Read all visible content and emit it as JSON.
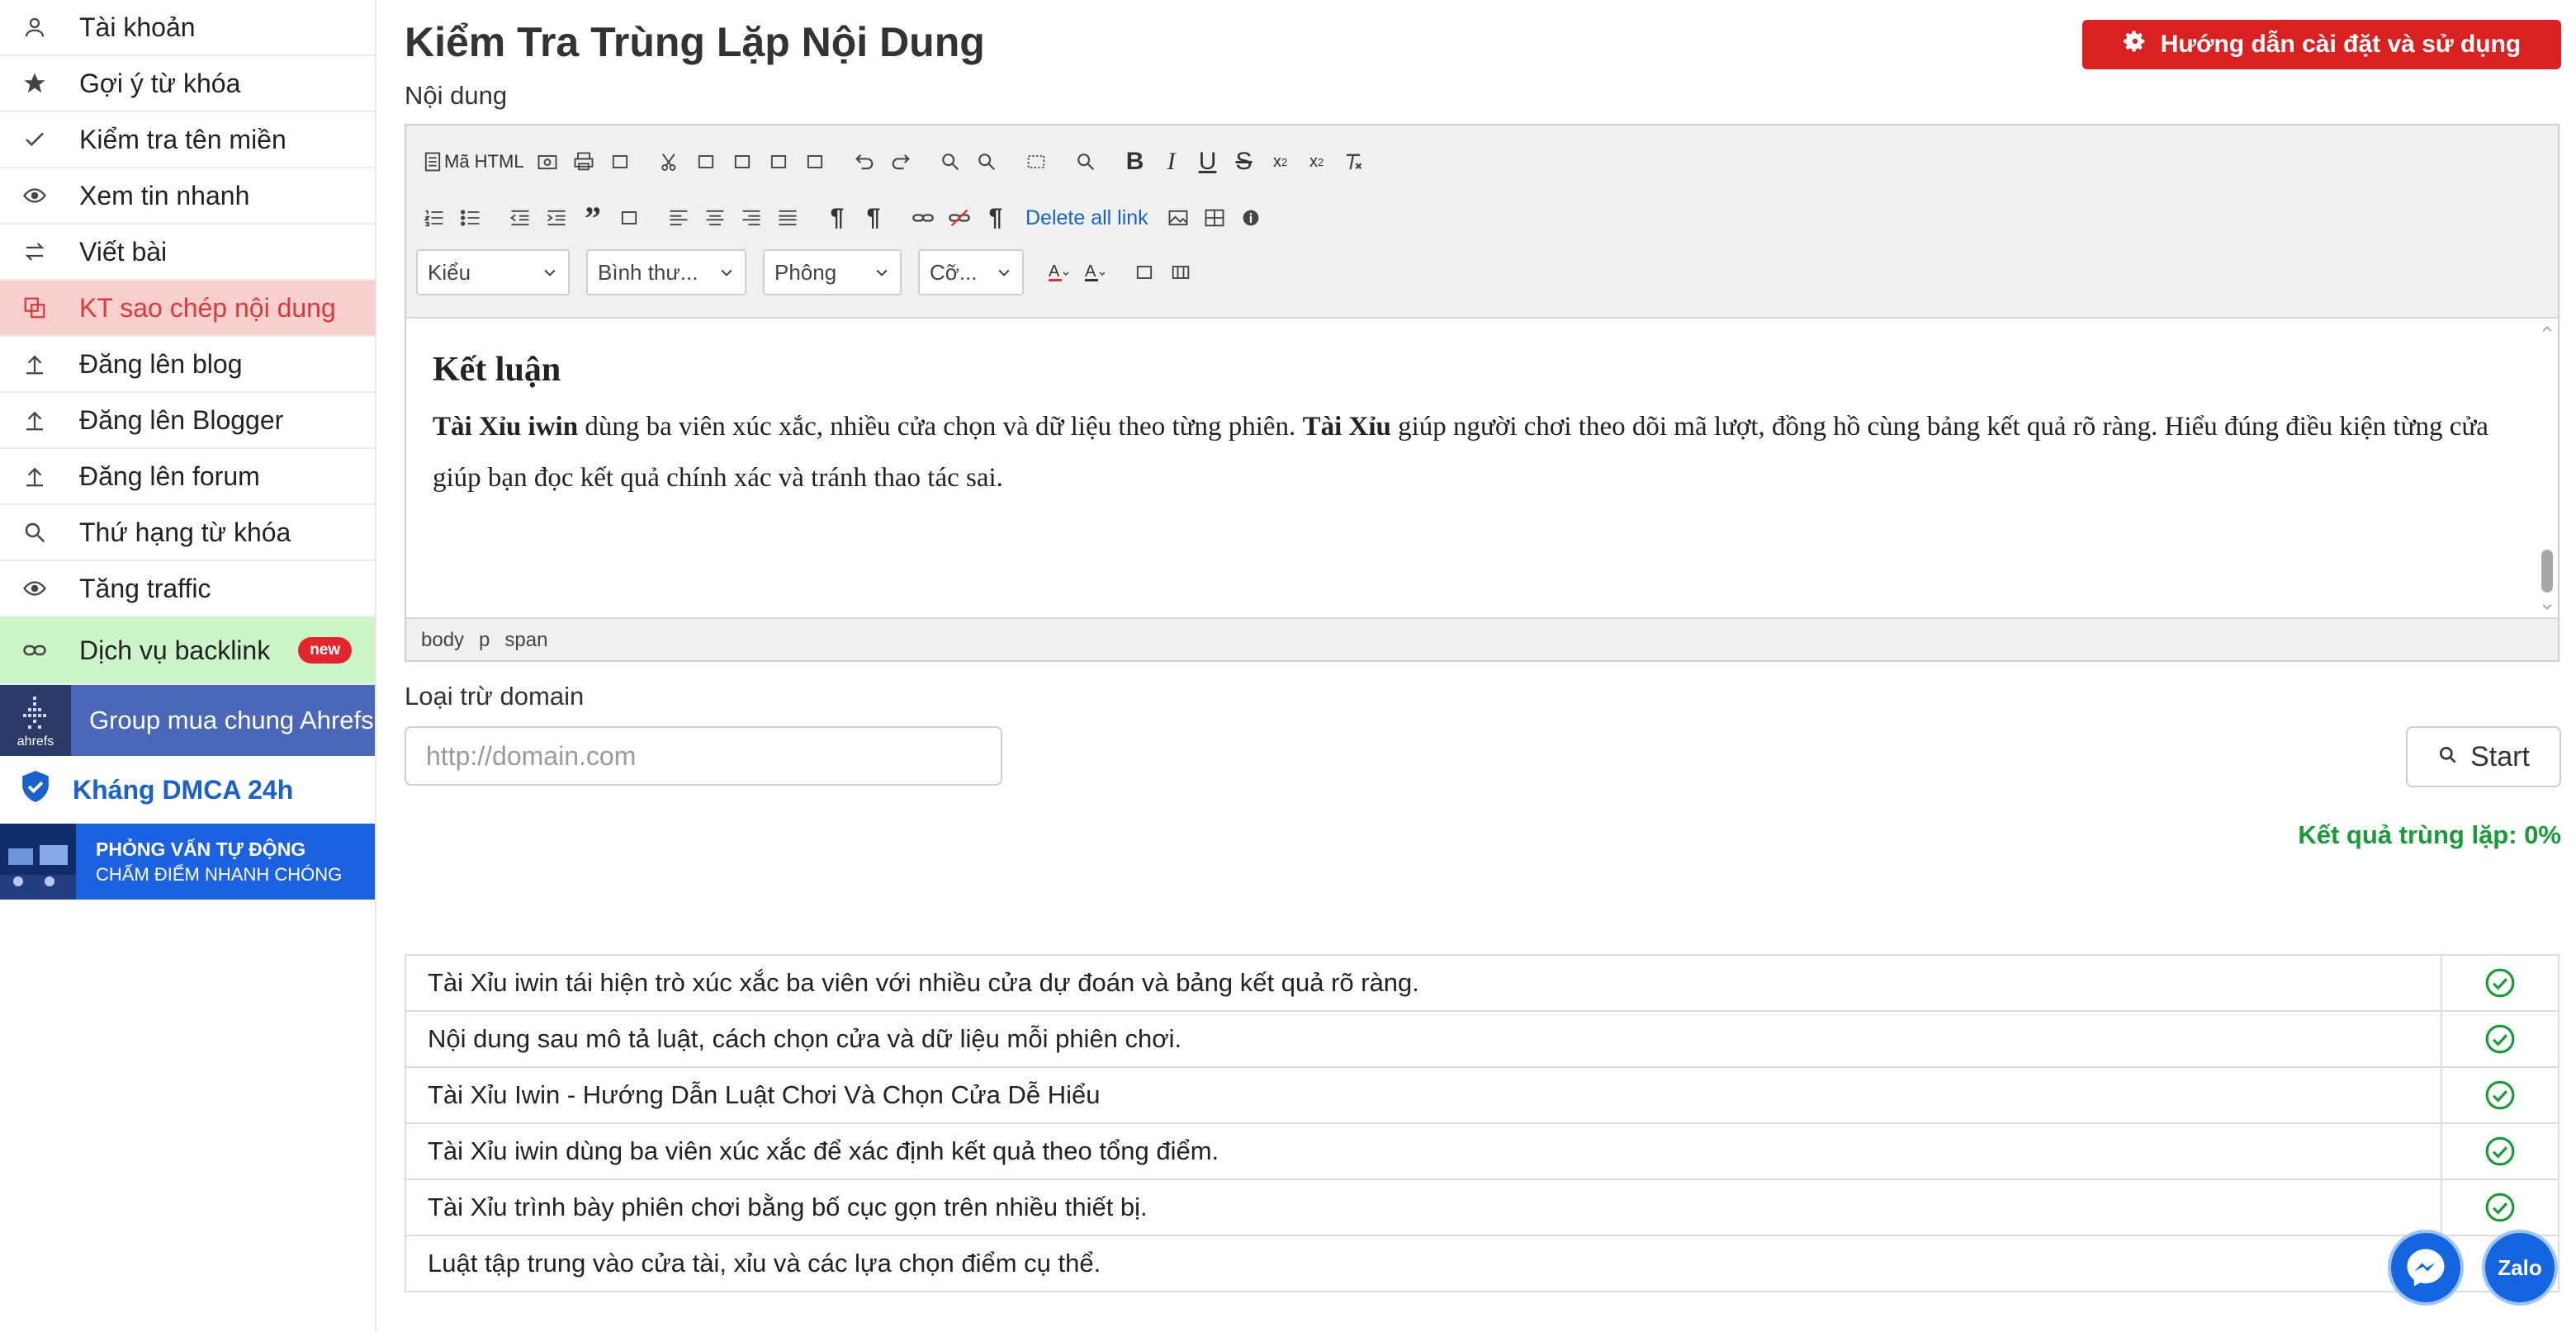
{
  "sidebar": {
    "items": [
      {
        "label": "Tài khoản",
        "icon": "user-icon"
      },
      {
        "label": "Gợi ý từ khóa",
        "icon": "star-icon"
      },
      {
        "label": "Kiểm tra tên miền",
        "icon": "check-icon"
      },
      {
        "label": "Xem tin nhanh",
        "icon": "eye-icon"
      },
      {
        "label": "Viết bài",
        "icon": "swap-icon"
      },
      {
        "label": "KT sao chép nội dung",
        "icon": "copy-icon",
        "active": true
      },
      {
        "label": "Đăng lên blog",
        "icon": "upload-icon"
      },
      {
        "label": "Đăng lên Blogger",
        "icon": "upload-icon"
      },
      {
        "label": "Đăng lên forum",
        "icon": "upload-icon"
      },
      {
        "label": "Thứ hạng từ khóa",
        "icon": "search-icon"
      },
      {
        "label": "Tăng traffic",
        "icon": "eye-icon"
      }
    ],
    "backlink": {
      "label": "Dịch vụ backlink",
      "badge": "new",
      "icon": "link-icon"
    },
    "ahrefs": {
      "logo_text": "ahrefs",
      "label": "Group mua chung Ahrefs"
    },
    "dmca": {
      "label": "Kháng DMCA 24h",
      "icon": "shield-check-icon"
    },
    "interview": {
      "line1": "PHỎNG VẤN TỰ ĐỘNG",
      "line2": "CHẤM ĐIỂM NHANH CHÓNG"
    }
  },
  "header": {
    "title": "Kiểm Tra Trùng Lặp Nội Dung",
    "guide_button": "Hướng dẫn cài đặt và sử dụng"
  },
  "content_label": "Nội dung",
  "toolbar": {
    "html_label": "Mã HTML",
    "delete_links": "Delete all link",
    "style_select": "Kiểu",
    "format_select": "Bình thư...",
    "font_select": "Phông",
    "size_select": "Cỡ..."
  },
  "editor": {
    "heading": "Kết luận",
    "b1": "Tài Xỉu iwin",
    "t1": " dùng ba viên xúc xắc, nhiều cửa chọn và dữ liệu theo từng phiên. ",
    "b2": "Tài Xỉu",
    "t2": " giúp người chơi theo dõi mã lượt, đồng hồ cùng bảng kết quả rõ ràng. Hiểu đúng điều kiện từng cửa giúp bạn đọc kết quả chính xác và tránh thao tác sai.",
    "path": [
      "body",
      "p",
      "span"
    ]
  },
  "exclude": {
    "label": "Loại trừ domain",
    "placeholder": "http://domain.com",
    "start_button": "Start"
  },
  "result_label": "Kết quả trùng lặp: 0%",
  "results": [
    {
      "text": "Tài Xỉu iwin tái hiện trò xúc xắc ba viên với nhiều cửa dự đoán và bảng kết quả rõ ràng.",
      "ok": true
    },
    {
      "text": "Nội dung sau mô tả luật, cách chọn cửa và dữ liệu mỗi phiên chơi.",
      "ok": true
    },
    {
      "text": "Tài Xỉu Iwin - Hướng Dẫn Luật Chơi Và Chọn Cửa Dễ Hiểu",
      "ok": true
    },
    {
      "text": "Tài Xỉu iwin dùng ba viên xúc xắc để xác định kết quả theo tổng điểm.",
      "ok": true
    },
    {
      "text": "Tài Xỉu trình bày phiên chơi bằng bố cục gọn trên nhiều thiết bị.",
      "ok": true
    },
    {
      "text": "Luật tập trung vào cửa tài, xỉu và các lựa chọn điểm cụ thể.",
      "ok": false
    }
  ],
  "floating": {
    "zalo_label": "Zalo"
  },
  "colors": {
    "accent_red": "#d92121",
    "success_green": "#1a9a38",
    "link_blue": "#1565c0"
  }
}
